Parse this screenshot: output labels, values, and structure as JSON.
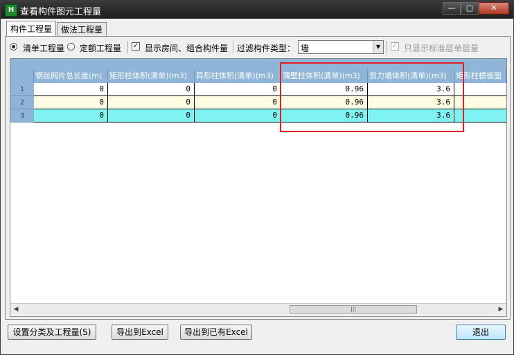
{
  "window": {
    "title": "查看构件图元工程量",
    "app_icon": "H",
    "minimize": "—",
    "maximize": "▢",
    "close": "✕"
  },
  "tabs": [
    {
      "label": "构件工程量",
      "active": true
    },
    {
      "label": "做法工程量",
      "active": false
    }
  ],
  "options": {
    "radio_qingdan": {
      "label": "清单工程量",
      "checked": true
    },
    "radio_dinge": {
      "label": "定额工程量",
      "checked": false
    },
    "check_room": {
      "label": "显示房间、组合构件量",
      "checked": true,
      "mark": "✓"
    },
    "filter_label": "过滤构件类型：",
    "filter_value": "墙",
    "filter_arrow": "▼",
    "check_standard": {
      "label": "只显示标准层单层量",
      "checked": true,
      "disabled": true,
      "mark": "✓"
    }
  },
  "grid": {
    "columns": [
      "钢丝网片总长度(m)",
      "矩形柱体积(清单)(m3)",
      "异形柱体积(清单)(m3)",
      "薄壁柱体积(清单)(m3)",
      "剪力墙体积(清单)(m3)",
      "矩形柱模板面"
    ],
    "rows": [
      {
        "num": "1",
        "cells": [
          "0",
          "0",
          "0",
          "0.96",
          "3.6",
          ""
        ]
      },
      {
        "num": "2",
        "cells": [
          "0",
          "0",
          "0",
          "0.96",
          "3.6",
          ""
        ]
      },
      {
        "num": "3",
        "cells": [
          "0",
          "0",
          "0",
          "0.96",
          "3.6",
          ""
        ]
      }
    ],
    "scroll_left": "◀",
    "scroll_right": "▶",
    "scroll_grip": "|||"
  },
  "buttons": {
    "settings": "设置分类及工程量(S)",
    "export_excel": "导出到Excel",
    "export_existing": "导出到已有Excel",
    "exit": "退出"
  },
  "colors": {
    "header_bg": "#8fb6d8",
    "row2_bg": "#fffde1",
    "row3_bg": "#7ff2f2",
    "highlight": "#e02020"
  }
}
